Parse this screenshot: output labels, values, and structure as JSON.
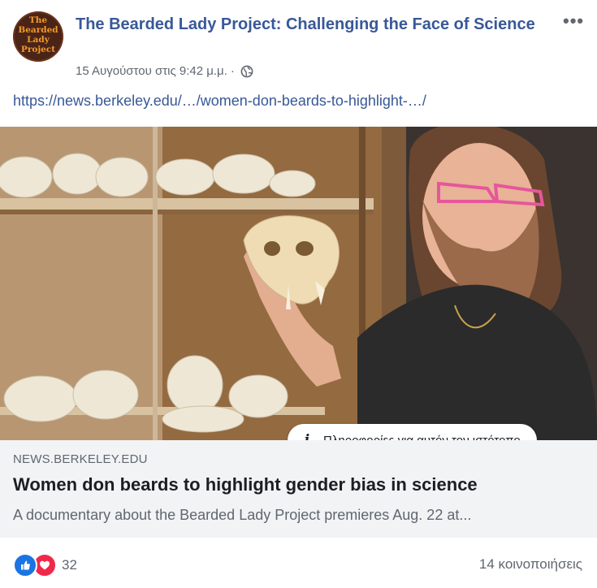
{
  "post": {
    "page_name": "The Bearded Lady Project: Challenging the Face of Science",
    "avatar_text": [
      "The",
      "Bearded",
      "Lady",
      "Project"
    ],
    "timestamp": "15 Αυγούστου στις 9:42 μ.μ.",
    "separator": "·",
    "link_url": "https://news.berkeley.edu/…/women-don-beards-to-highlight-…/"
  },
  "link_card": {
    "info_label": "Πληροφορίες για αυτόν τον ιστότοπο",
    "domain": "NEWS.BERKELEY.EDU",
    "headline": "Women don beards to highlight gender bias in science",
    "description": "A documentary about the Bearded Lady Project premieres Aug. 22 at..."
  },
  "footer": {
    "reaction_count": "32",
    "shares": "14 κοινοποιήσεις"
  },
  "icons": {
    "like": "like-icon",
    "love": "love-icon",
    "globe": "globe-icon",
    "more": "more-icon",
    "info": "info-icon"
  },
  "colors": {
    "link_blue": "#385898",
    "like_blue": "#1b74e4",
    "love_red": "#f0284a",
    "card_bg": "#f2f3f5",
    "muted_text": "#606770"
  }
}
